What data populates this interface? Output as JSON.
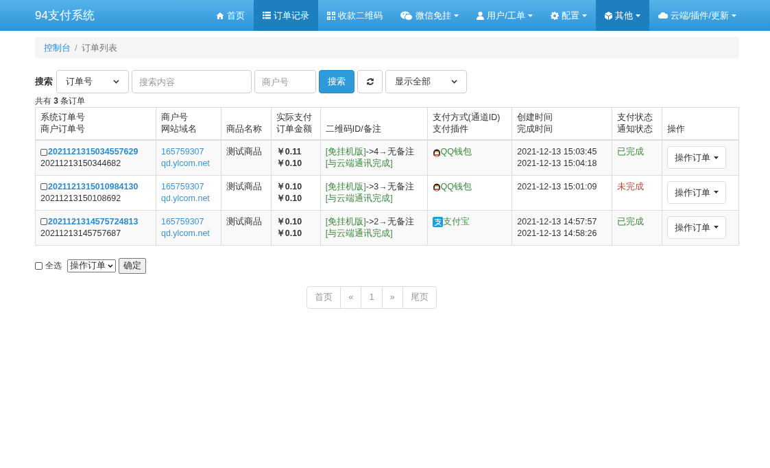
{
  "brand": "94支付系统",
  "nav": [
    {
      "label": "首页",
      "kind": "home",
      "dropdown": false,
      "selected": false
    },
    {
      "label": "订单记录",
      "kind": "list",
      "dropdown": false,
      "selected": true
    },
    {
      "label": "收款二维码",
      "kind": "qrcode",
      "dropdown": false,
      "selected": false
    },
    {
      "label": "微信免挂",
      "kind": "wechat",
      "dropdown": true,
      "selected": false
    },
    {
      "label": "用户/工单",
      "kind": "user",
      "dropdown": true,
      "selected": false
    },
    {
      "label": "配置",
      "kind": "gear",
      "dropdown": true,
      "selected": false
    },
    {
      "label": "其他",
      "kind": "cube",
      "dropdown": true,
      "selected": true
    },
    {
      "label": "云端/插件/更新",
      "kind": "cloud",
      "dropdown": true,
      "selected": false
    }
  ],
  "breadcrumb": [
    "控制台",
    "订单列表"
  ],
  "breadcrumb_separator": "/",
  "search": {
    "label": "搜索",
    "type_select": "订单号",
    "content_placeholder": "搜索内容",
    "merchant_placeholder": "商户号",
    "button": "搜索",
    "filter_select": "显示全部"
  },
  "total": "共有 **3** 条订单",
  "table": {
    "columns": [
      [
        "系统订单号",
        "商户订单号"
      ],
      [
        "商户号",
        "网站域名"
      ],
      [
        "商品名称"
      ],
      [
        "实际支付",
        "订单金额"
      ],
      [
        "二维码ID/备注"
      ],
      [
        "支付方式(通道ID)",
        "支付插件"
      ],
      [
        "创建时间",
        "完成时间"
      ],
      [
        "支付状态",
        "通知状态"
      ],
      [
        "操作"
      ]
    ],
    "rows": [
      {
        "checked": false,
        "sys_no": "2021121315034557629",
        "merchant_no": "20211213150344682",
        "merchant_id": "165759307",
        "domain": "qd.ylcom.net",
        "product": "测试商品",
        "paid": "￥0.11",
        "amount": "￥0.10",
        "remark_tag": "[免挂机版]",
        "remark_text": "->4→无备注",
        "remark_status": "[与云端通讯完成]",
        "kind": "qq",
        "pay_method": "QQ钱包",
        "created": "2021-12-13 15:03:45",
        "completed": "2021-12-13 15:04:18",
        "status": "已完成",
        "done": true,
        "action": "操作订单"
      },
      {
        "checked": false,
        "sys_no": "2021121315010984130",
        "merchant_no": "20211213150108692",
        "merchant_id": "165759307",
        "domain": "qd.ylcom.net",
        "product": "测试商品",
        "paid": "￥0.10",
        "amount": "￥0.10",
        "remark_tag": "[免挂机版]",
        "remark_text": "->3→无备注",
        "remark_status": "[与云端通讯完成]",
        "kind": "qq",
        "pay_method": "QQ钱包",
        "created": "2021-12-13 15:01:09",
        "status": "未完成",
        "done": false,
        "action": "操作订单"
      },
      {
        "checked": false,
        "sys_no": "2021121314575724813",
        "merchant_no": "20211213145757687",
        "merchant_id": "165759307",
        "domain": "qd.ylcom.net",
        "product": "测试商品",
        "paid": "￥0.10",
        "amount": "￥0.10",
        "remark_tag": "[免挂机版]",
        "remark_text": "->2→无备注",
        "remark_status": "[与云端通讯完成]",
        "kind": "alipay",
        "pay_method": "支付宝",
        "created": "2021-12-13 14:57:57",
        "completed": "2021-12-13 14:58:26",
        "status": "已完成",
        "done": true,
        "action": "操作订单"
      }
    ]
  },
  "bulk": {
    "select_all": "全选",
    "select_all_checked": false,
    "action_select": "操作订单",
    "confirm": "确定"
  },
  "pagination": [
    {
      "label": "首页",
      "selected": false
    },
    {
      "label": "«",
      "selected": false
    },
    {
      "label": "1",
      "selected": false
    },
    {
      "label": "»",
      "selected": false
    },
    {
      "label": "尾页",
      "selected": false
    }
  ]
}
